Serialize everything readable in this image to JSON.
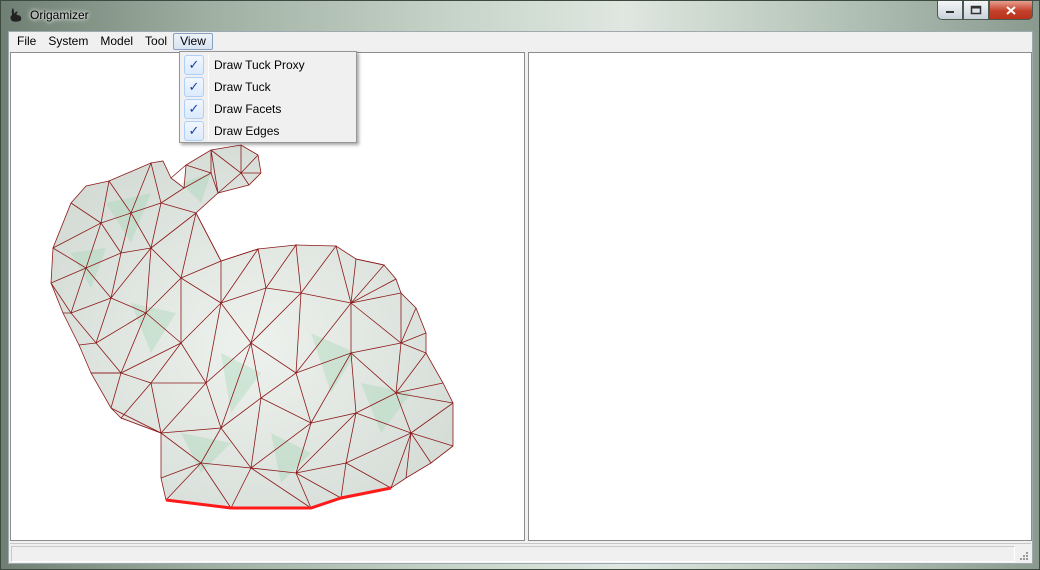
{
  "window": {
    "title": "Origamizer",
    "controls": {
      "minimize_icon": "minimize-icon",
      "maximize_icon": "maximize-icon",
      "close_icon": "close-icon"
    }
  },
  "menubar": {
    "items": [
      {
        "label": "File"
      },
      {
        "label": "System"
      },
      {
        "label": "Model"
      },
      {
        "label": "Tool"
      },
      {
        "label": "View",
        "active": true
      }
    ]
  },
  "view_menu": {
    "items": [
      {
        "label": "Draw Tuck Proxy",
        "checked": true
      },
      {
        "label": "Draw Tuck",
        "checked": true
      },
      {
        "label": "Draw Facets",
        "checked": true
      },
      {
        "label": "Draw Edges",
        "checked": true
      }
    ],
    "check_glyph": "✓"
  },
  "viewport": {
    "left_pane": "3d-mesh-view",
    "right_pane": "2d-crease-pattern-view",
    "mesh_edge_color": "#8b1a1a",
    "boundary_color": "#ff1a1a",
    "fill_color": "#e3e8e4",
    "tint_color": "#9fd6b2"
  },
  "colors": {
    "menu_active_border": "#8aa0c0",
    "check_color": "#1c3ea8",
    "close_button": "#c4402a"
  }
}
